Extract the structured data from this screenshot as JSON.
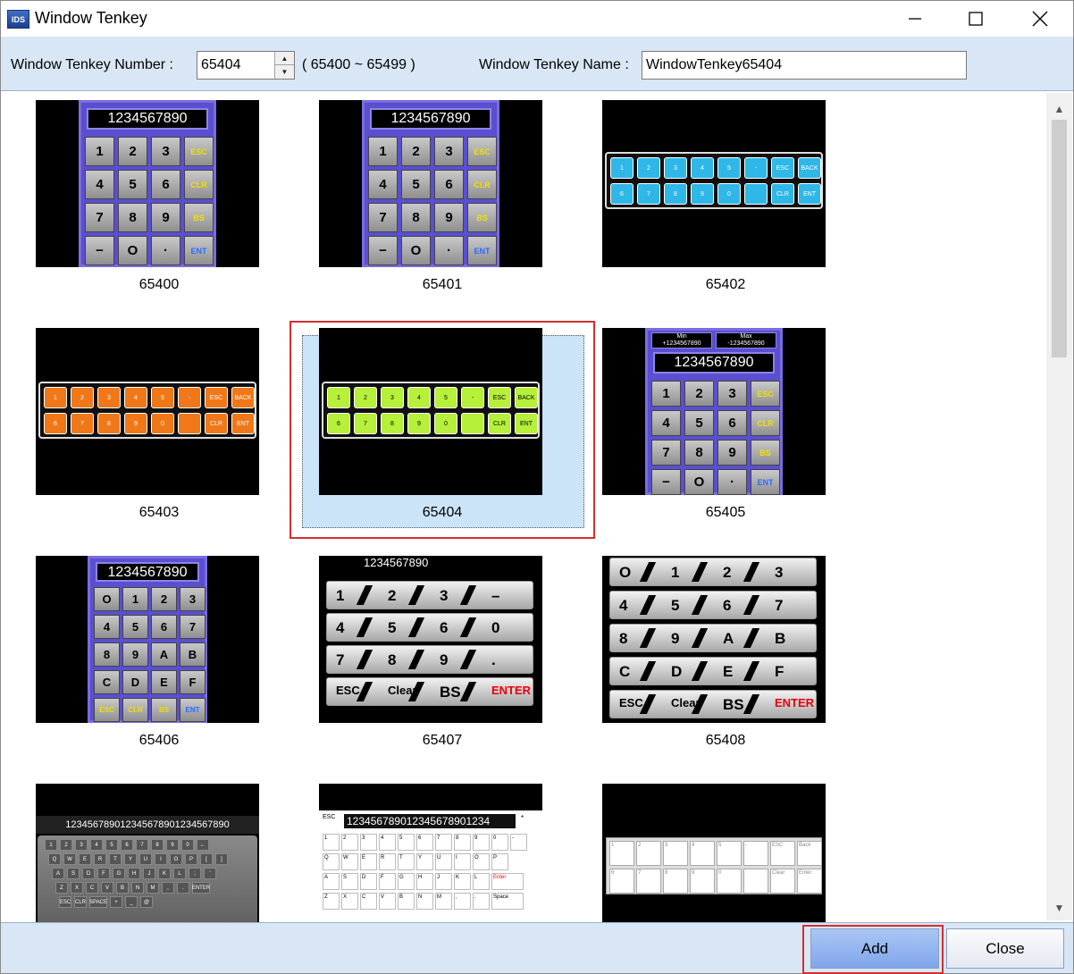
{
  "window": {
    "title": "Window Tenkey",
    "icon_text": "IDS"
  },
  "toolbar": {
    "number_label": "Window Tenkey Number :",
    "number_value": "65404",
    "range": "( 65400 ~ 65499 )",
    "name_label": "Window Tenkey Name :",
    "name_value": "WindowTenkey65404"
  },
  "tiles": [
    {
      "id": "65400"
    },
    {
      "id": "65401"
    },
    {
      "id": "65402"
    },
    {
      "id": "65403"
    },
    {
      "id": "65404",
      "selected": true
    },
    {
      "id": "65405"
    },
    {
      "id": "65406"
    },
    {
      "id": "65407"
    },
    {
      "id": "65408"
    },
    {
      "id": ""
    },
    {
      "id": ""
    },
    {
      "id": ""
    }
  ],
  "keypad": {
    "display": "1234567890",
    "keys": [
      "1",
      "2",
      "3",
      "ESC",
      "4",
      "5",
      "6",
      "CLR",
      "7",
      "8",
      "9",
      "BS",
      "−",
      "O",
      "·",
      "ENT"
    ],
    "keys_hex": [
      "O",
      "1",
      "2",
      "3",
      "4",
      "5",
      "6",
      "7",
      "8",
      "9",
      "A",
      "B",
      "C",
      "D",
      "E",
      "F",
      "ESC",
      "CLR",
      "BS",
      "ENT"
    ],
    "bar_row1": [
      "1",
      "2",
      "3",
      "4",
      "5",
      "-",
      "ESC",
      "BACK"
    ],
    "bar_row2": [
      "6",
      "7",
      "8",
      "9",
      "0",
      "",
      "CLR",
      "ENT"
    ],
    "dual_display": [
      "+1234567890",
      "-1234567890"
    ],
    "dual_labels": [
      "Min",
      "Max"
    ],
    "block_rows": [
      [
        "1",
        "2",
        "3",
        "–"
      ],
      [
        "4",
        "5",
        "6",
        "0"
      ],
      [
        "7",
        "8",
        "9",
        "."
      ],
      [
        "ESC",
        "Clear",
        "BS",
        "ENTER"
      ]
    ],
    "block_rows2": [
      [
        "O",
        "1",
        "2",
        "3"
      ],
      [
        "4",
        "5",
        "6",
        "7"
      ],
      [
        "8",
        "9",
        "A",
        "B"
      ],
      [
        "C",
        "D",
        "E",
        "F"
      ],
      [
        "ESC",
        "Clear",
        "BS",
        "ENTER"
      ]
    ],
    "long_display": "123456789012345678901234567890",
    "long_display2": "123456789012345678901234",
    "kb_rows": [
      [
        "1",
        "2",
        "3",
        "4",
        "5",
        "6",
        "7",
        "8",
        "9",
        "0",
        "←"
      ],
      [
        "Q",
        "W",
        "E",
        "R",
        "T",
        "Y",
        "U",
        "I",
        "O",
        "P",
        "[",
        "]"
      ],
      [
        "A",
        "S",
        "D",
        "F",
        "G",
        "H",
        "J",
        "K",
        "L",
        ";",
        "'"
      ],
      [
        "Z",
        "X",
        "C",
        "V",
        "B",
        "N",
        "M",
        ",",
        ".",
        "ENTER"
      ],
      [
        "ESC",
        "CLR",
        "SPACE",
        "+",
        "_",
        "@"
      ]
    ],
    "white_row1": [
      "1",
      "2",
      "3",
      "4",
      "5",
      "-",
      "ESC",
      "Back"
    ],
    "white_row2": [
      "6",
      "7",
      "8",
      "9",
      "0",
      "",
      "Clear",
      "Enter"
    ],
    "white_kb_rows": [
      [
        "1",
        "2",
        "3",
        "4",
        "5",
        "6",
        "7",
        "8",
        "9",
        "0",
        "-"
      ],
      [
        "Q",
        "W",
        "E",
        "R",
        "T",
        "Y",
        "U",
        "I",
        "O",
        "P"
      ],
      [
        "A",
        "S",
        "D",
        "F",
        "G",
        "H",
        "J",
        "K",
        "L",
        "Enter"
      ],
      [
        "Z",
        "X",
        "C",
        "V",
        "B",
        "N",
        "M",
        ",",
        ".",
        "Space"
      ]
    ],
    "white_esc": "ESC",
    "white_star": "*"
  },
  "colors": {
    "bar_blue": "#2fb7e8",
    "bar_orange": "#f07818",
    "bar_green": "#b6f03a",
    "keypad_frame": "#5a4fcf",
    "highlight": "#d32f2f"
  },
  "footer": {
    "add": "Add",
    "close": "Close"
  }
}
